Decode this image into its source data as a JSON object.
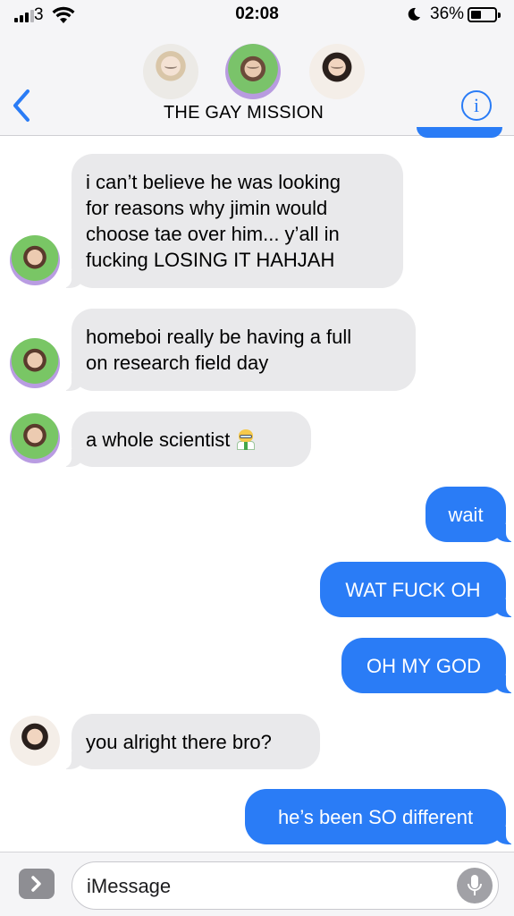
{
  "status_bar": {
    "carrier": "3",
    "time": "02:08",
    "battery_percent": "36%",
    "battery_level": 0.36,
    "icons": [
      "signal-icon",
      "wifi-icon",
      "do-not-disturb-moon-icon",
      "battery-icon"
    ]
  },
  "header": {
    "title": "THE GAY MISSION",
    "back_icon": "chevron-left-icon",
    "info_label": "i",
    "accent_color": "#2a7cf6"
  },
  "messages": [
    {
      "direction": "incoming",
      "text": "i can’t believe he was looking for reasons why jimin would choose tae over him... y’all in fucking LOSING IT HAHJAH",
      "lines": [
        "i can’t believe he was looking",
        "for reasons why jimin would",
        "choose tae over him... y’all in",
        "fucking LOSING IT HAHJAH"
      ]
    },
    {
      "direction": "incoming",
      "text": "homeboi really be having a full on research field day",
      "lines": [
        "homeboi really be having a full",
        "on research field day"
      ]
    },
    {
      "direction": "incoming",
      "text": "a whole scientist",
      "emoji": "scientist-emoji"
    },
    {
      "direction": "outgoing",
      "text": "wait"
    },
    {
      "direction": "outgoing",
      "text": "WAT FUCK OH"
    },
    {
      "direction": "outgoing",
      "text": "OH MY GOD"
    },
    {
      "direction": "incoming",
      "text": "you alright there bro?"
    },
    {
      "direction": "outgoing",
      "text": "he’s been SO different"
    }
  ],
  "input": {
    "placeholder": "iMessage",
    "apps_icon": "chevron-right-icon",
    "mic_icon": "microphone-icon"
  },
  "colors": {
    "incoming_bubble": "#e9e9eb",
    "outgoing_bubble": "#2a7cf6",
    "header_bg": "#f5f5f7"
  }
}
